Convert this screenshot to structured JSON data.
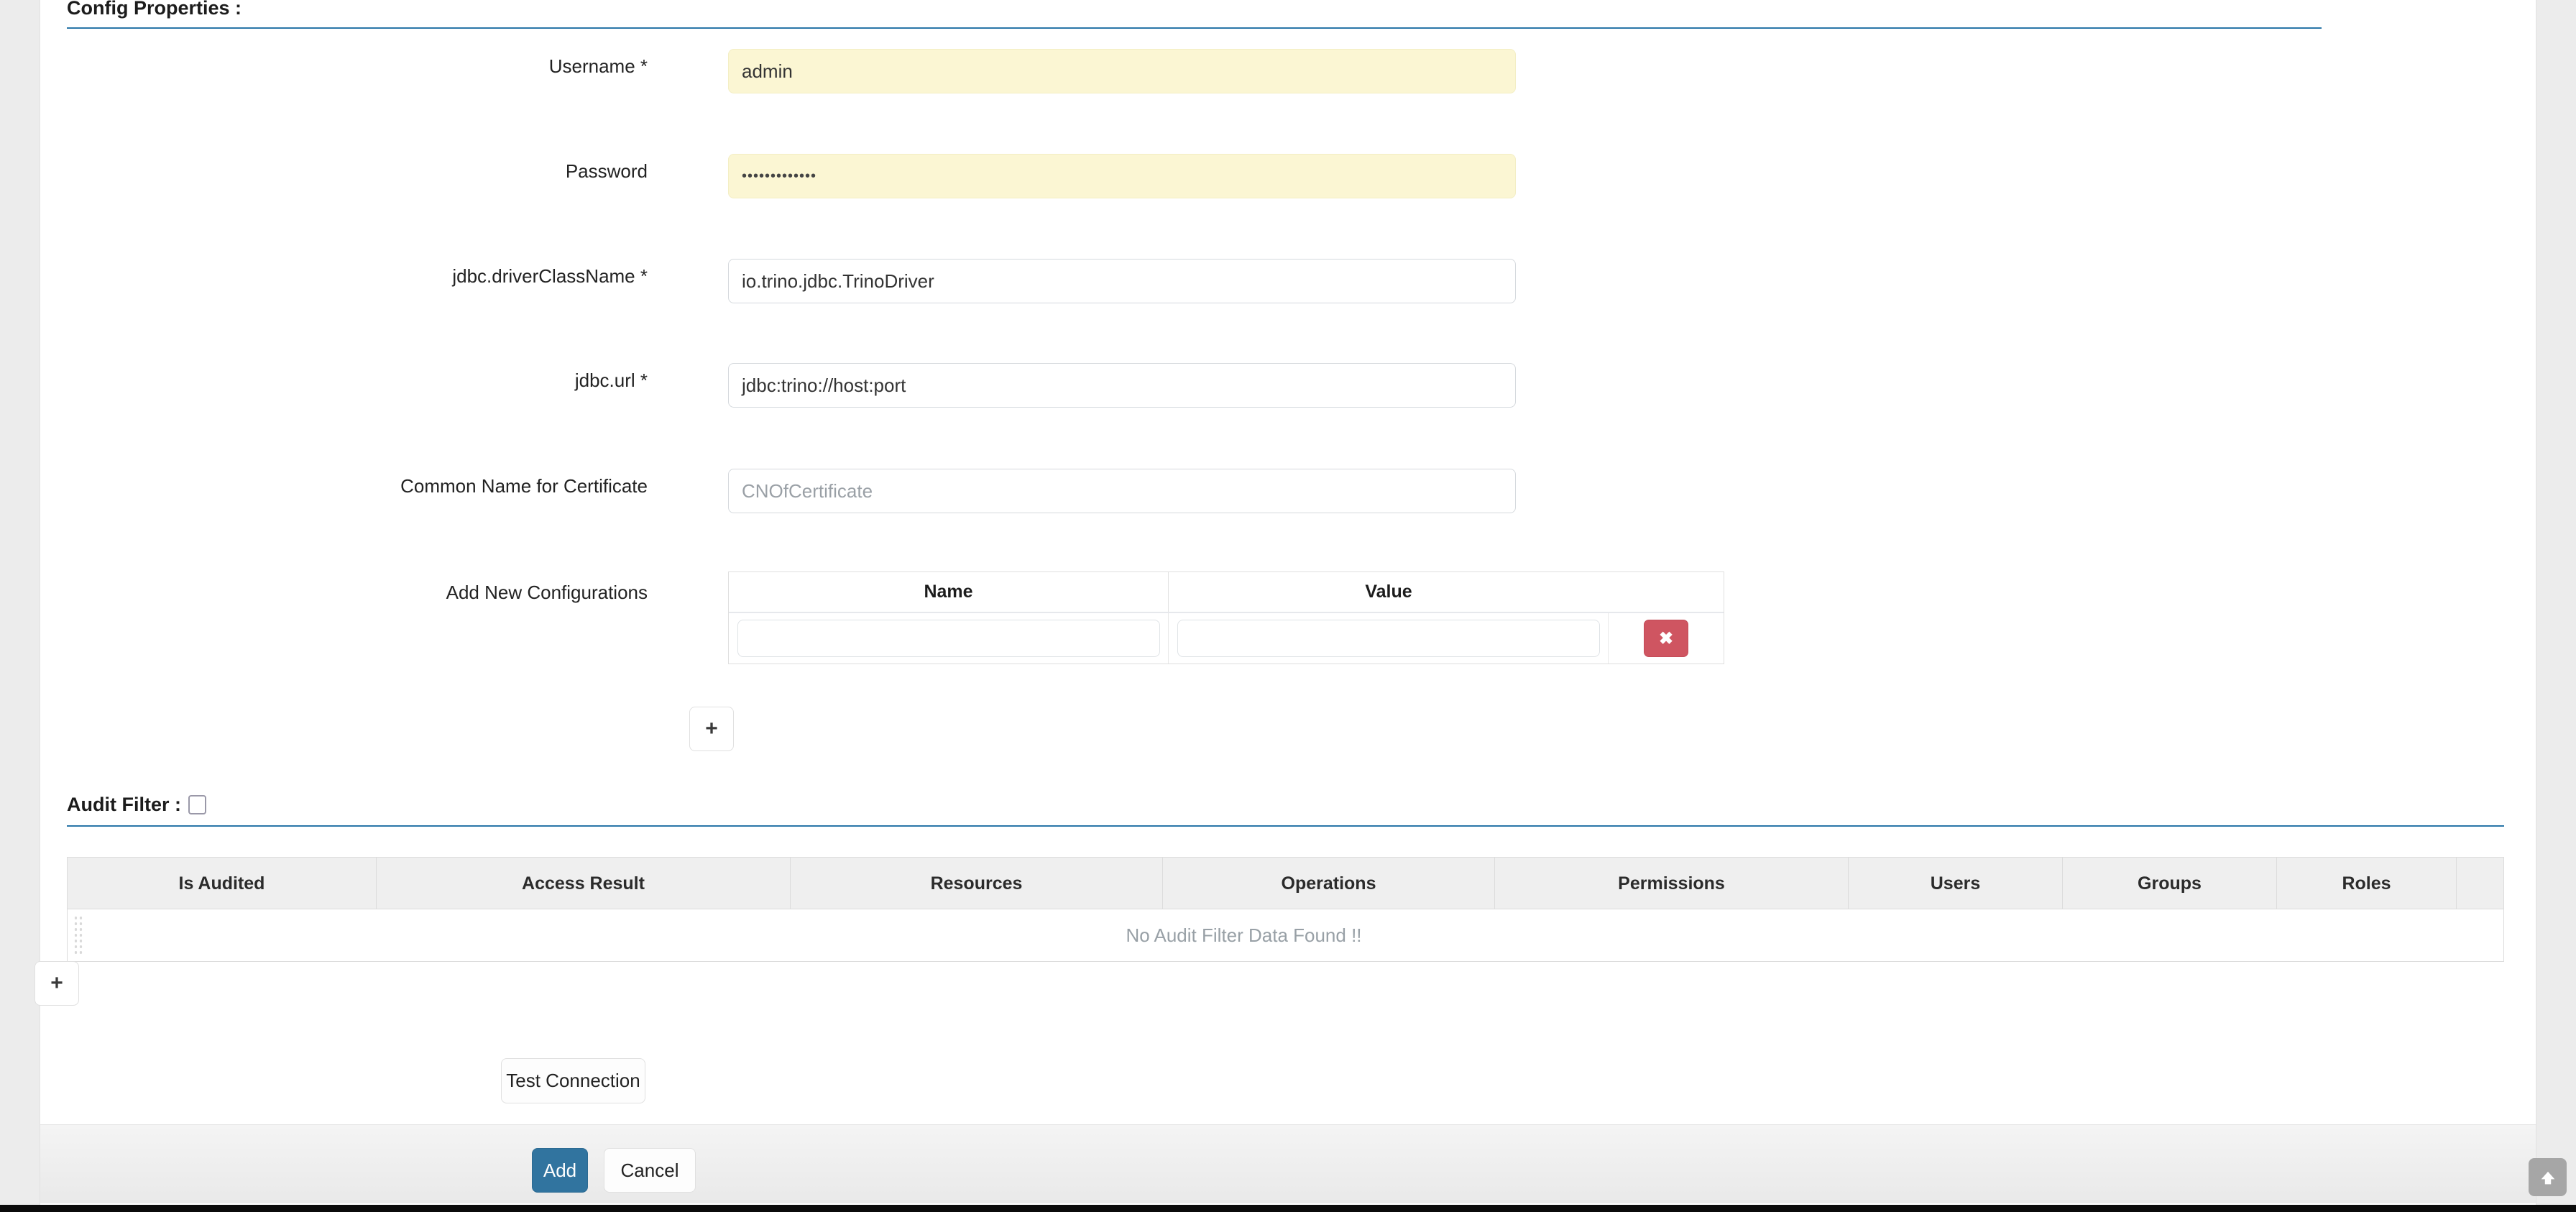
{
  "config_section": {
    "title": "Config Properties :",
    "fields": [
      {
        "label": "Username *",
        "value": "admin",
        "kind": "autofill"
      },
      {
        "label": "Password",
        "value": "•••••••••••••",
        "kind": "autofill-password"
      },
      {
        "label": "jdbc.driverClassName *",
        "value": "io.trino.jdbc.TrinoDriver",
        "kind": "text"
      },
      {
        "label": "jdbc.url *",
        "value": "jdbc:trino://host:port",
        "kind": "text"
      },
      {
        "label": "Common Name for Certificate",
        "value": "CNOfCertificate",
        "kind": "placeholder"
      }
    ],
    "add_new_configurations": {
      "label": "Add New Configurations",
      "columns": [
        "Name",
        "Value"
      ],
      "rows": [
        {
          "name": "",
          "value": "",
          "name_placeholder": "",
          "value_placeholder": ""
        }
      ],
      "delete_icon_label": "✖",
      "add_row_label": "+"
    }
  },
  "audit_section": {
    "title": "Audit Filter :",
    "checkbox_checked": false,
    "columns": [
      "Is Audited",
      "Access Result",
      "Resources",
      "Operations",
      "Permissions",
      "Users",
      "Groups",
      "Roles"
    ],
    "empty_message": "No Audit Filter Data Found !!",
    "add_row_label": "+"
  },
  "actions": {
    "test_connection": "Test Connection",
    "add": "Add",
    "cancel": "Cancel"
  },
  "scroll_top": {
    "label": "▲"
  },
  "colors": {
    "accent_rule": "#2a76a8",
    "primary_button": "#31749f",
    "delete_button": "#cf5561",
    "autofill_background": "#fbf6d3",
    "muted_text": "#98a0a6"
  }
}
